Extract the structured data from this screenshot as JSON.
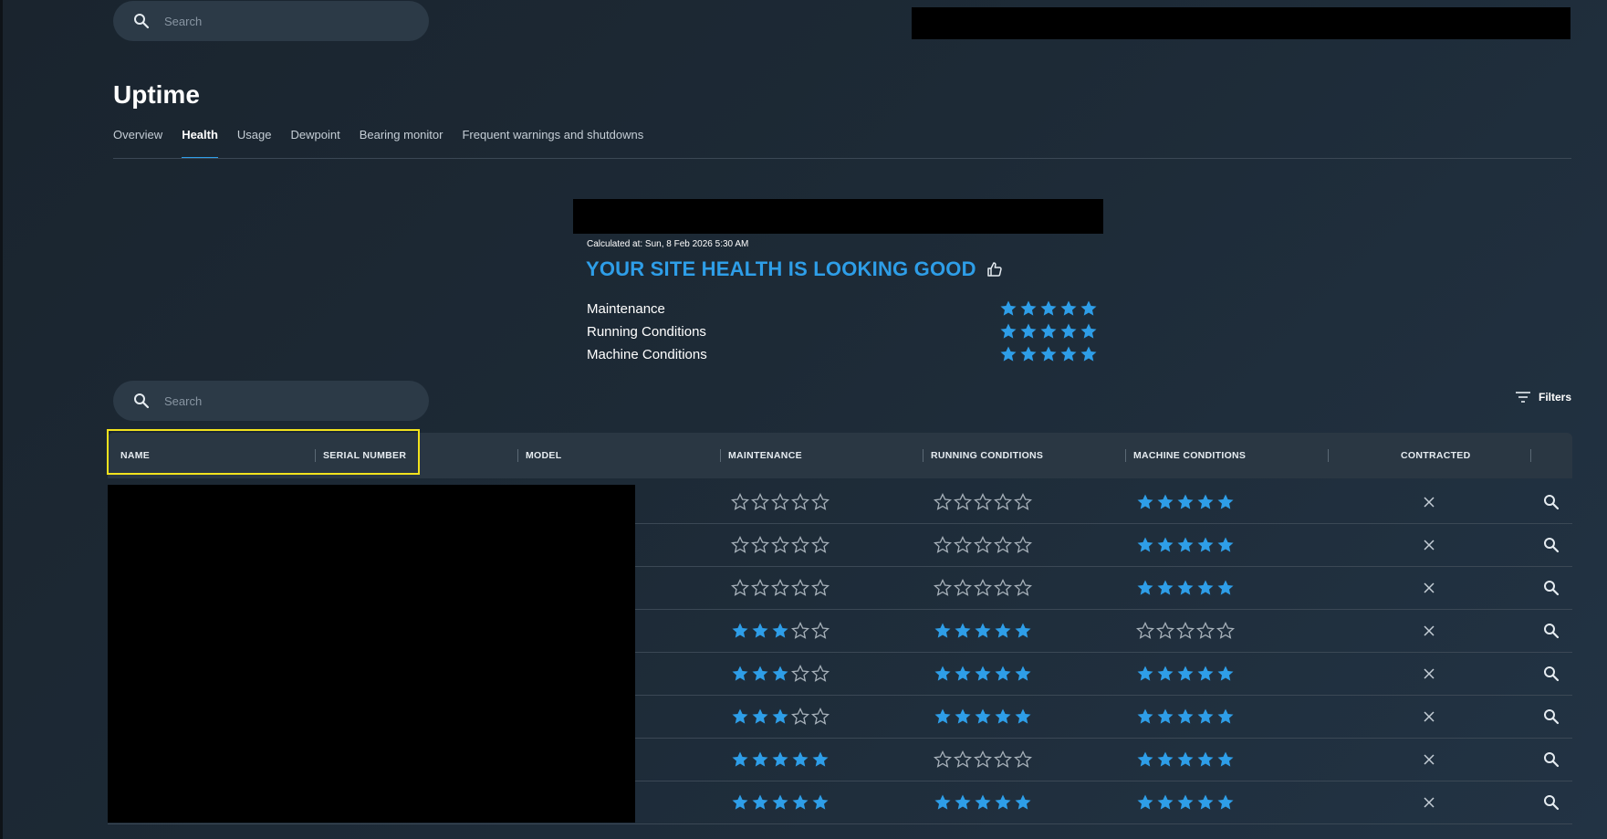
{
  "top_search": {
    "placeholder": "Search"
  },
  "page": {
    "title": "Uptime"
  },
  "tabs": [
    {
      "label": "Overview",
      "active": false
    },
    {
      "label": "Health",
      "active": true
    },
    {
      "label": "Usage",
      "active": false
    },
    {
      "label": "Dewpoint",
      "active": false
    },
    {
      "label": "Bearing monitor",
      "active": false
    },
    {
      "label": "Frequent warnings and shutdowns",
      "active": false
    }
  ],
  "health_summary": {
    "calculated_at": "Calculated at: Sun, 8 Feb 2026 5:30 AM",
    "headline": "YOUR SITE HEALTH IS LOOKING GOOD",
    "ratings": [
      {
        "label": "Maintenance",
        "stars": 5
      },
      {
        "label": "Running Conditions",
        "stars": 5
      },
      {
        "label": "Machine Conditions",
        "stars": 5
      }
    ]
  },
  "table_search": {
    "placeholder": "Search"
  },
  "filters": {
    "label": "Filters"
  },
  "table": {
    "columns": [
      {
        "label": "NAME"
      },
      {
        "label": "SERIAL NUMBER"
      },
      {
        "label": "MODEL"
      },
      {
        "label": "MAINTENANCE"
      },
      {
        "label": "RUNNING CONDITIONS"
      },
      {
        "label": "MACHINE CONDITIONS"
      },
      {
        "label": "CONTRACTED"
      }
    ],
    "rows": [
      {
        "maintenance": 0,
        "running": 0,
        "machine": 5,
        "contracted": false
      },
      {
        "maintenance": 0,
        "running": 0,
        "machine": 5,
        "contracted": false
      },
      {
        "maintenance": 0,
        "running": 0,
        "machine": 5,
        "contracted": false
      },
      {
        "maintenance": 3,
        "running": 5,
        "machine": 0,
        "contracted": false
      },
      {
        "maintenance": 3,
        "running": 5,
        "machine": 5,
        "contracted": false
      },
      {
        "maintenance": 3,
        "running": 5,
        "machine": 5,
        "contracted": false
      },
      {
        "maintenance": 5,
        "running": 0,
        "machine": 5,
        "contracted": false
      },
      {
        "maintenance": 5,
        "running": 5,
        "machine": 5,
        "contracted": false
      }
    ]
  },
  "colors": {
    "accent": "#2e9ee8",
    "background": "#1b2631",
    "highlight": "#f2e21d"
  }
}
